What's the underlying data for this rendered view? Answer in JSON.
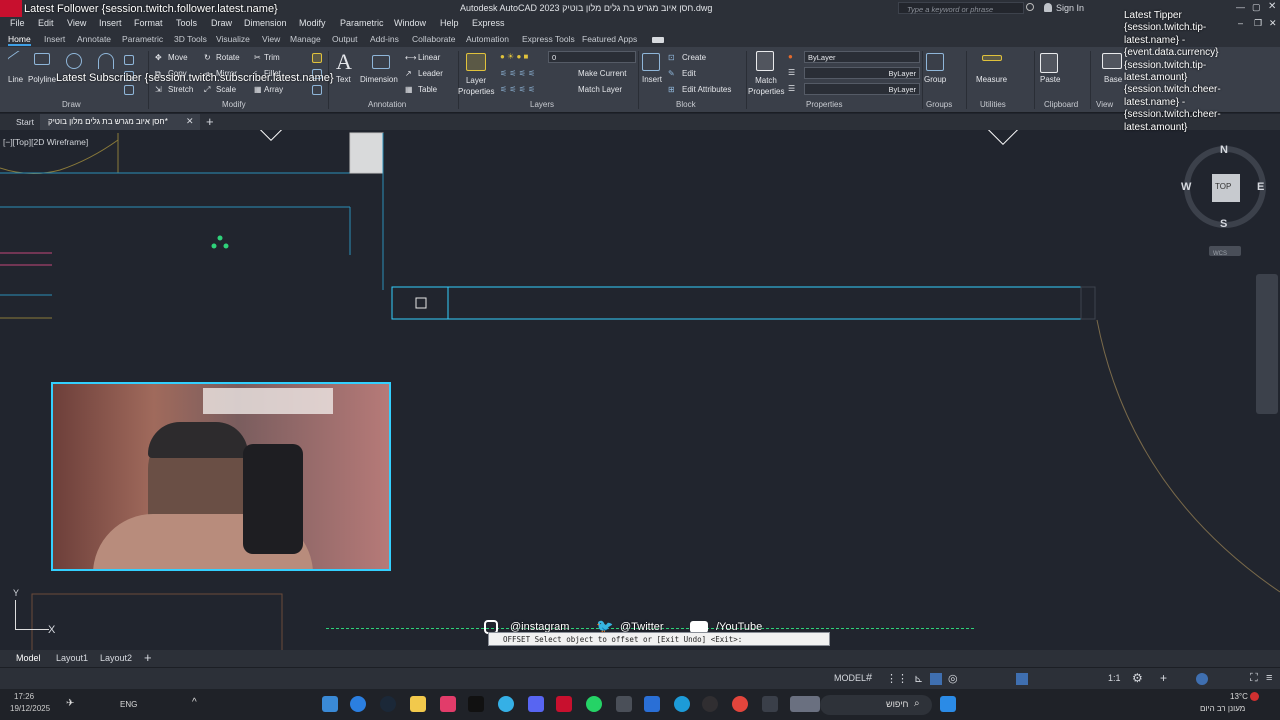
{
  "window": {
    "title": "Autodesk AutoCAD 2023  חסן איוב מגרש בת גלים מלון בוטיק.dwg",
    "search_placeholder": "Type a keyword or phrase",
    "sign_in": "Sign In"
  },
  "menu": [
    "File",
    "Edit",
    "View",
    "Insert",
    "Format",
    "Tools",
    "Draw",
    "Dimension",
    "Modify",
    "Parametric",
    "Window",
    "Help",
    "Express"
  ],
  "ribbon_tabs": [
    "Home",
    "Insert",
    "Annotate",
    "Parametric",
    "3D Tools",
    "Visualize",
    "View",
    "Manage",
    "Output",
    "Add-ins",
    "Collaborate",
    "Automation",
    "Express Tools",
    "Featured Apps"
  ],
  "ribbon": {
    "draw": {
      "line": "Line",
      "polyline": "Polyline",
      "panel": "Draw"
    },
    "modify": {
      "move": "Move",
      "rotate": "Rotate",
      "trim": "Trim",
      "copy": "Copy",
      "mirror": "Mirror",
      "fillet": "Fillet",
      "stretch": "Stretch",
      "scale": "Scale",
      "array": "Array",
      "panel": "Modify"
    },
    "annotation": {
      "text": "Text",
      "dimension": "Dimension",
      "linear": "Linear",
      "leader": "Leader",
      "table": "Table",
      "panel": "Annotation"
    },
    "layers": {
      "layer_properties": "Layer Properties",
      "layer_value": "0",
      "make_current": "Make Current",
      "match_layer": "Match Layer",
      "panel": "Layers"
    },
    "insert": {
      "insert": "Insert",
      "panel": "Block"
    },
    "block": {
      "create": "Create",
      "edit": "Edit",
      "edit_attributes": "Edit Attributes",
      "panel": "Block"
    },
    "properties": {
      "match_properties": "Match Properties",
      "bylayer1": "ByLayer",
      "bylayer2": "ByLayer",
      "bylayer3": "ByLayer",
      "panel": "Properties"
    },
    "groups": {
      "group": "Group",
      "panel": "Groups"
    },
    "utilities": {
      "measure": "Measure",
      "panel": "Utilities"
    },
    "clipboard": {
      "paste": "Paste",
      "panel": "Clipboard"
    },
    "view": {
      "base": "Base",
      "panel": "View"
    }
  },
  "file_tabs": {
    "start": "Start",
    "current": "חסן איוב מגרש בת גלים מלון בוטיק*"
  },
  "viewport_label": "[−][Top][2D Wireframe]",
  "viewcube": {
    "n": "N",
    "s": "S",
    "e": "E",
    "w": "W",
    "top": "TOP",
    "wcs": "WCS"
  },
  "ucs": {
    "y": "Y",
    "x": "X"
  },
  "command_line": "OFFSET Select object to offset or [Exit Undo] <Exit>:",
  "social": {
    "instagram": "@instagram",
    "twitter": "@Twitter",
    "youtube": "/YouTube"
  },
  "overlays": {
    "latest_follower": "Latest Follower {session.twitch.follower.latest.name}",
    "latest_subscriber": "Latest Subscriber {session.twitch.subscriber.latest.name}",
    "latest_tipper": [
      "Latest Tipper",
      "{session.twitch.tip-",
      "latest.name} -",
      "{event.data.currency}",
      "{session.twitch.tip-",
      "latest.amount}",
      "{session.twitch.cheer-",
      "latest.name} -",
      "{session.twitch.cheer-",
      "latest.amount}"
    ]
  },
  "layout_tabs": [
    "Model",
    "Layout1",
    "Layout2"
  ],
  "status": {
    "model": "MODEL",
    "scale": "1:1"
  },
  "taskbar": {
    "time": "17:26",
    "date": "19/12/2025",
    "lang": "ENG",
    "search": "חיפוש",
    "weather_temp": "13°C",
    "weather_desc": "מעונן רב היום"
  },
  "colors": {
    "accent": "#3fa0e6",
    "viewport_lines": "#33d0ff",
    "ribbon_bg": "#3a3f49",
    "canvas_bg": "#21252e"
  }
}
